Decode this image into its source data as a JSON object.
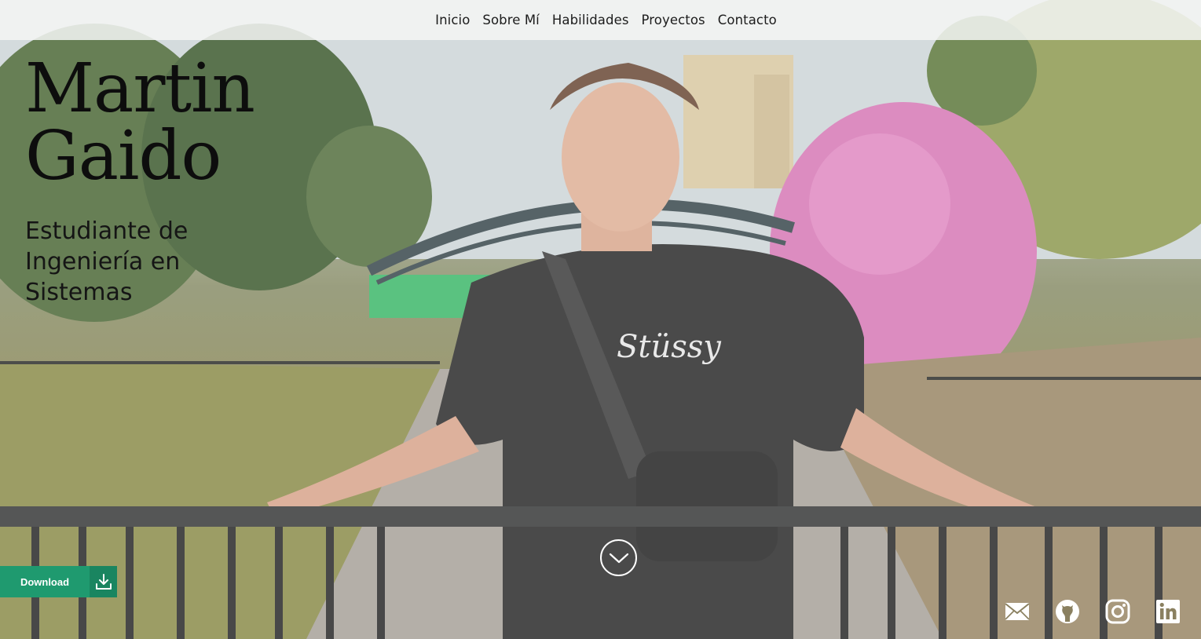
{
  "nav": {
    "items": [
      {
        "label": "Inicio"
      },
      {
        "label": "Sobre Mí"
      },
      {
        "label": "Habilidades"
      },
      {
        "label": "Proyectos"
      },
      {
        "label": "Contacto"
      }
    ]
  },
  "hero": {
    "name_first": "Martin",
    "name_last": "Gaido",
    "subtitle": "Estudiante de Ingeniería en Sistemas"
  },
  "download": {
    "label": "Download",
    "icon": "download-icon"
  },
  "scroll": {
    "icon": "chevron-down-icon"
  },
  "socials": [
    {
      "name": "email",
      "icon": "envelope-icon"
    },
    {
      "name": "github",
      "icon": "github-icon"
    },
    {
      "name": "instagram",
      "icon": "instagram-icon"
    },
    {
      "name": "linkedin",
      "icon": "linkedin-icon"
    }
  ],
  "colors": {
    "download_bg": "#1f9a6f",
    "navbar_bg": "#f5f6f4",
    "text_dark": "#0d0d0d",
    "icons": "#ffffff"
  }
}
